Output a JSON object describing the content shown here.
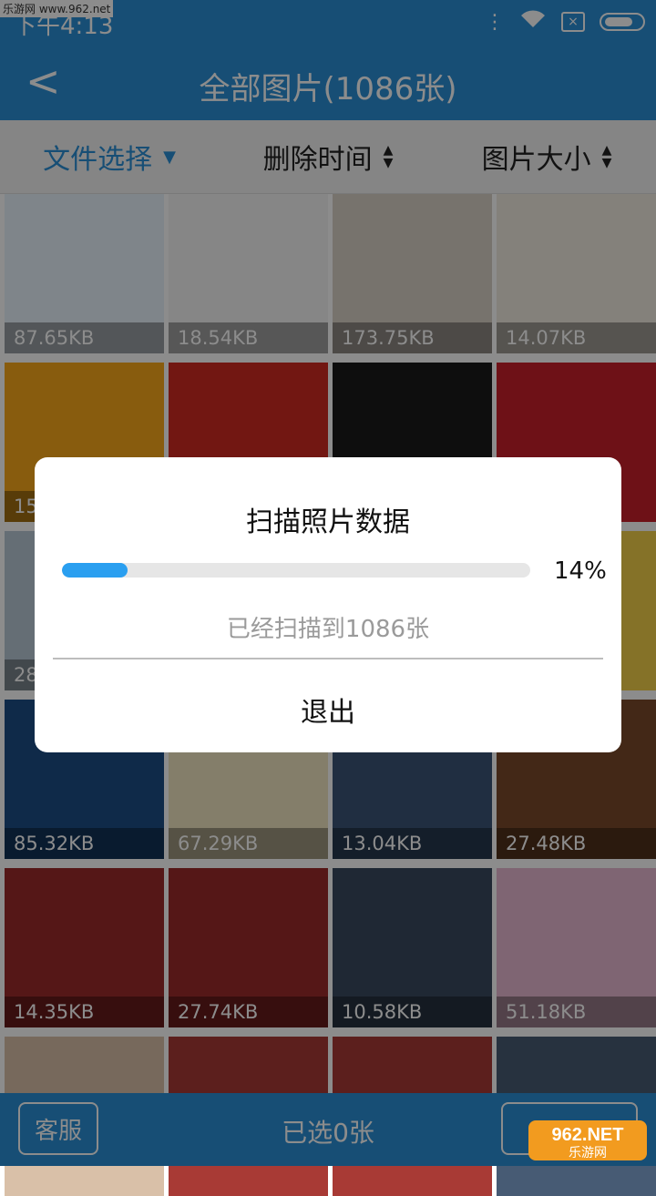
{
  "status_bar": {
    "time": "下午4:13",
    "watermark": "乐游网 www.962.net"
  },
  "header": {
    "back_label": "<",
    "title": "全部图片(1086张)"
  },
  "sort_bar": {
    "items": [
      {
        "label": "文件选择",
        "active": true
      },
      {
        "label": "删除时间",
        "active": false
      },
      {
        "label": "图片大小",
        "active": false
      }
    ]
  },
  "grid": {
    "cells": [
      {
        "size": "87.65KB",
        "color": "#e8f2fb"
      },
      {
        "size": "18.54KB",
        "color": "#f4f4f4"
      },
      {
        "size": "173.75KB",
        "color": "#d9d2c6"
      },
      {
        "size": "14.07KB",
        "color": "#f1ece0"
      },
      {
        "size": "15",
        "color": "#f7a81b"
      },
      {
        "size": "",
        "color": "#cf2b22"
      },
      {
        "size": "",
        "color": "#1b1b1b"
      },
      {
        "size": "",
        "color": "#c8202a"
      },
      {
        "size": "28",
        "color": "#b8c9d6"
      },
      {
        "size": "",
        "color": "#eaeaea"
      },
      {
        "size": "",
        "color": "#e9e9e9"
      },
      {
        "size": "",
        "color": "#f3d04a"
      },
      {
        "size": "85.32KB",
        "color": "#1d4e86"
      },
      {
        "size": "67.29KB",
        "color": "#f1e6c2"
      },
      {
        "size": "13.04KB",
        "color": "#3b5577"
      },
      {
        "size": "27.48KB",
        "color": "#7a4a2a"
      },
      {
        "size": "14.35KB",
        "color": "#9c2a2a"
      },
      {
        "size": "27.74KB",
        "color": "#9c2a2a"
      },
      {
        "size": "10.58KB",
        "color": "#3a4a60"
      },
      {
        "size": "51.18KB",
        "color": "#e7b8d2"
      },
      {
        "size": "",
        "color": "#d9c0a8"
      },
      {
        "size": "",
        "color": "#a83a35"
      },
      {
        "size": "",
        "color": "#a83a35"
      },
      {
        "size": "",
        "color": "#475b74"
      }
    ]
  },
  "bottom_bar": {
    "service_label": "客服",
    "selected_label": "已选0张"
  },
  "dialog": {
    "title": "扫描照片数据",
    "progress_fraction": 0.14,
    "progress_text": "14%",
    "message": "已经扫描到1086张",
    "exit_label": "退出"
  },
  "brand": {
    "text": "962.NET",
    "subtext": "乐游网"
  },
  "colors": {
    "accent": "#2a8fd6",
    "progress": "#2a9ff0"
  }
}
